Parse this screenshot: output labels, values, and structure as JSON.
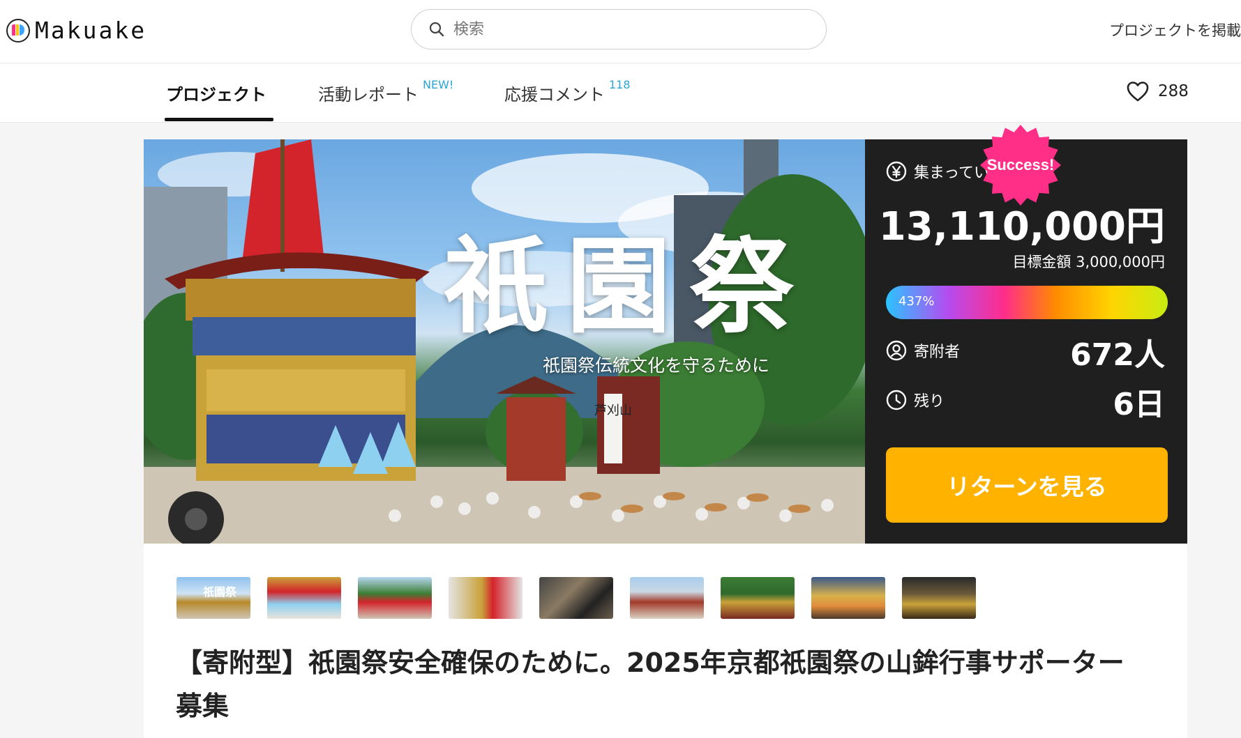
{
  "header": {
    "logo_text": "Makuake",
    "search_placeholder": "検索",
    "post_project": "プロジェクトを掲載"
  },
  "tabs": [
    {
      "label": "プロジェクト",
      "sup": ""
    },
    {
      "label": "活動レポート",
      "sup": "NEW!"
    },
    {
      "label": "応援コメント",
      "sup": "118"
    }
  ],
  "favorites": {
    "count": "288"
  },
  "hero": {
    "calligraphy": "祇園祭",
    "tagline": "祇園祭伝統文化を守るために",
    "banner_chars": "芦刈山"
  },
  "stats": {
    "collected_label": "集まっている金額",
    "collected_amount": "13,110,000円",
    "target": "目標金額 3,000,000円",
    "progress_text": "437%",
    "progress_value": 4.37,
    "supporters_label": "寄附者",
    "supporters_value": "672人",
    "remaining_label": "残り",
    "remaining_value": "6日",
    "return_button": "リターンを見る"
  },
  "badge": {
    "text": "Success!",
    "color": "#ff2e86"
  },
  "colors": {
    "accent": "#ffb300",
    "panel": "#1f1f1f",
    "new_label": "#2aa4d8"
  },
  "thumbnails": [
    {
      "icon": "festival-title-thumb",
      "text": "祇園祭"
    },
    {
      "icon": "float-crowd-thumb",
      "text": ""
    },
    {
      "icon": "float-street-thumb",
      "text": ""
    },
    {
      "icon": "float-building-thumb",
      "text": ""
    },
    {
      "icon": "ropes-hands-thumb",
      "text": ""
    },
    {
      "icon": "parade-floats-thumb",
      "text": ""
    },
    {
      "icon": "floats-trees-thumb",
      "text": ""
    },
    {
      "icon": "lantern-night-thumb",
      "text": ""
    },
    {
      "icon": "night-crowd-thumb",
      "text": ""
    }
  ],
  "project": {
    "title": "【寄附型】祇園祭安全確保のために。2025年京都祇園祭の山鉾行事サポーター募集"
  }
}
